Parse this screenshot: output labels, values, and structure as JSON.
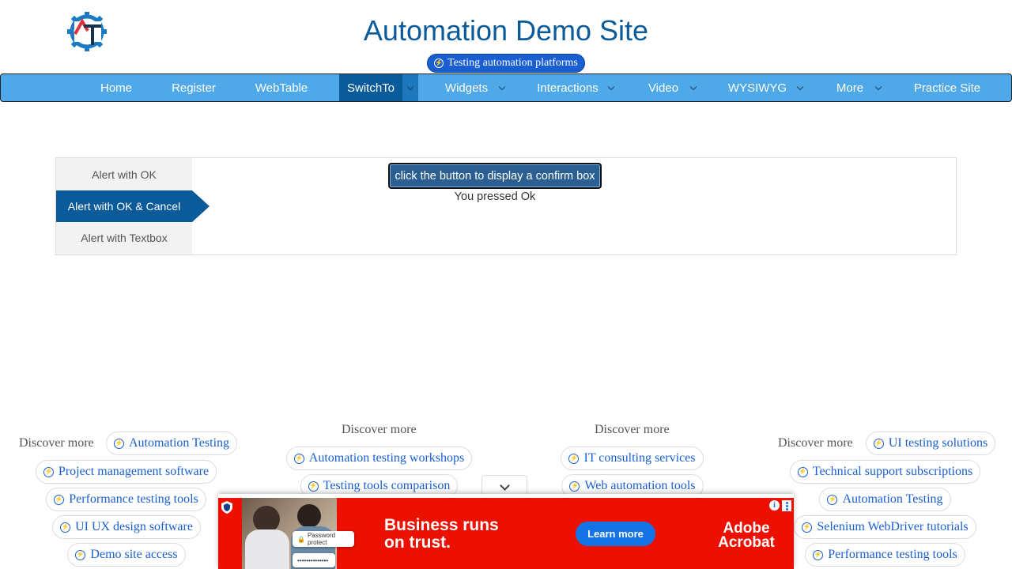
{
  "header": {
    "title": "Automation Demo Site",
    "chip": "Testing automation platforms"
  },
  "nav": {
    "items": [
      {
        "label": "Home"
      },
      {
        "label": "Register"
      },
      {
        "label": "WebTable"
      },
      {
        "label": "SwitchTo",
        "active": true
      },
      {
        "label": "Widgets"
      },
      {
        "label": "Interactions"
      },
      {
        "label": "Video"
      },
      {
        "label": "WYSIWYG"
      },
      {
        "label": "More"
      },
      {
        "label": "Practice Site"
      }
    ]
  },
  "alerts": {
    "tabs": [
      "Alert with OK",
      "Alert with OK & Cancel",
      "Alert with Textbox"
    ],
    "active_tab": "Alert with OK & Cancel",
    "button_label": "click the button to display a confirm box",
    "result": "You pressed Ok"
  },
  "discover": {
    "label": "Discover more",
    "col1": [
      "Automation Testing",
      "Project management software",
      "Performance testing tools",
      "UI UX design software",
      "Demo site access"
    ],
    "col2": [
      "Automation testing workshops",
      "Testing tools comparison"
    ],
    "col3": [
      "IT consulting services",
      "Web automation tools"
    ],
    "col4": [
      "UI testing solutions",
      "Technical support subscriptions",
      "Automation Testing",
      "Selenium WebDriver tutorials",
      "Performance testing tools"
    ]
  },
  "ad": {
    "headline_line1": "Business runs",
    "headline_line2": "on trust.",
    "cta": "Learn more",
    "brand_line1": "Adobe",
    "brand_line2": "Acrobat",
    "field1": "Password protect",
    "field2": "••••••••••••••",
    "bg_color": "#eb1000",
    "cta_color": "#1473e6"
  },
  "colors": {
    "nav_bg": "#4fa9e8",
    "nav_active": "#0b5a9a",
    "title": "#0b5a9a",
    "pill_text": "#1a5fd1"
  }
}
